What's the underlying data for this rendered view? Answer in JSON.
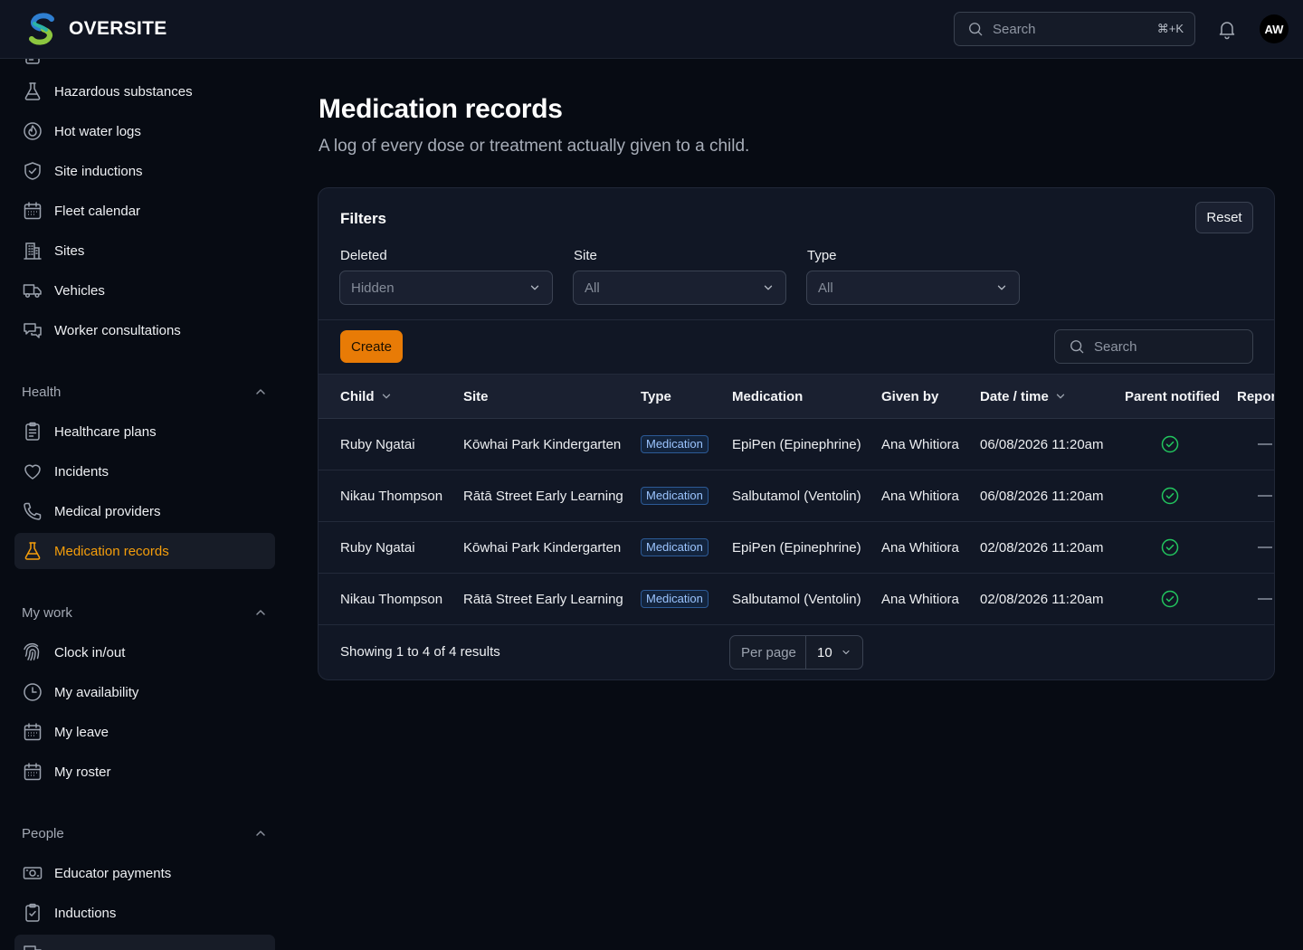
{
  "app": {
    "brand": "OVERSITE",
    "avatar_initials": "AW",
    "search_placeholder": "Search",
    "search_shortcut": "⌘+K"
  },
  "sidebar": {
    "items_top": [
      {
        "label": "Hazardous substances",
        "icon": "flask-icon"
      },
      {
        "label": "Hot water logs",
        "icon": "flame-icon"
      },
      {
        "label": "Site inductions",
        "icon": "shield-check-icon"
      },
      {
        "label": "Fleet calendar",
        "icon": "calendar-icon"
      },
      {
        "label": "Sites",
        "icon": "building-icon"
      },
      {
        "label": "Vehicles",
        "icon": "truck-icon"
      },
      {
        "label": "Worker consultations",
        "icon": "chat-bubbles-icon"
      }
    ],
    "health": {
      "title": "Health",
      "items": [
        {
          "label": "Healthcare plans",
          "icon": "clipboard-icon"
        },
        {
          "label": "Incidents",
          "icon": "heart-icon"
        },
        {
          "label": "Medical providers",
          "icon": "phone-icon"
        },
        {
          "label": "Medication records",
          "icon": "flask-icon",
          "active": true
        }
      ]
    },
    "my_work": {
      "title": "My work",
      "items": [
        {
          "label": "Clock in/out",
          "icon": "fingerprint-icon"
        },
        {
          "label": "My availability",
          "icon": "clock-icon"
        },
        {
          "label": "My leave",
          "icon": "calendar-icon"
        },
        {
          "label": "My roster",
          "icon": "calendar-icon"
        }
      ]
    },
    "people": {
      "title": "People",
      "items": [
        {
          "label": "Educator payments",
          "icon": "banknote-icon"
        },
        {
          "label": "Inductions",
          "icon": "clipboard-check-icon"
        }
      ]
    }
  },
  "page": {
    "title": "Medication records",
    "subtitle": "A log of every dose or treatment actually given to a child."
  },
  "filters": {
    "title": "Filters",
    "reset_label": "Reset",
    "deleted": {
      "label": "Deleted",
      "value": "Hidden"
    },
    "site": {
      "label": "Site",
      "value": "All"
    },
    "type": {
      "label": "Type",
      "value": "All"
    }
  },
  "toolbar": {
    "create_label": "Create",
    "search_placeholder": "Search"
  },
  "table": {
    "columns": [
      "Child",
      "Site",
      "Type",
      "Medication",
      "Given by",
      "Date / time",
      "Parent notified",
      "Repor"
    ],
    "rows": [
      {
        "child": "Ruby Ngatai",
        "site": "Kōwhai Park Kindergarten",
        "type": "Medication",
        "medication": "EpiPen (Epinephrine)",
        "given_by": "Ana Whitiora",
        "datetime": "06/08/2026 11:20am",
        "parent_notified": true
      },
      {
        "child": "Nikau Thompson",
        "site": "Rātā Street Early Learning",
        "type": "Medication",
        "medication": "Salbutamol (Ventolin)",
        "given_by": "Ana Whitiora",
        "datetime": "06/08/2026 11:20am",
        "parent_notified": true
      },
      {
        "child": "Ruby Ngatai",
        "site": "Kōwhai Park Kindergarten",
        "type": "Medication",
        "medication": "EpiPen (Epinephrine)",
        "given_by": "Ana Whitiora",
        "datetime": "02/08/2026 11:20am",
        "parent_notified": true
      },
      {
        "child": "Nikau Thompson",
        "site": "Rātā Street Early Learning",
        "type": "Medication",
        "medication": "Salbutamol (Ventolin)",
        "given_by": "Ana Whitiora",
        "datetime": "02/08/2026 11:20am",
        "parent_notified": true
      }
    ]
  },
  "pagination": {
    "showing": "Showing 1 to 4 of 4 results",
    "per_page_label": "Per page",
    "per_page_value": "10"
  },
  "colors": {
    "accent": "#f59e0b",
    "create_button": "#e87b06",
    "success": "#22c55e",
    "badge_text": "#9cc5ff"
  }
}
